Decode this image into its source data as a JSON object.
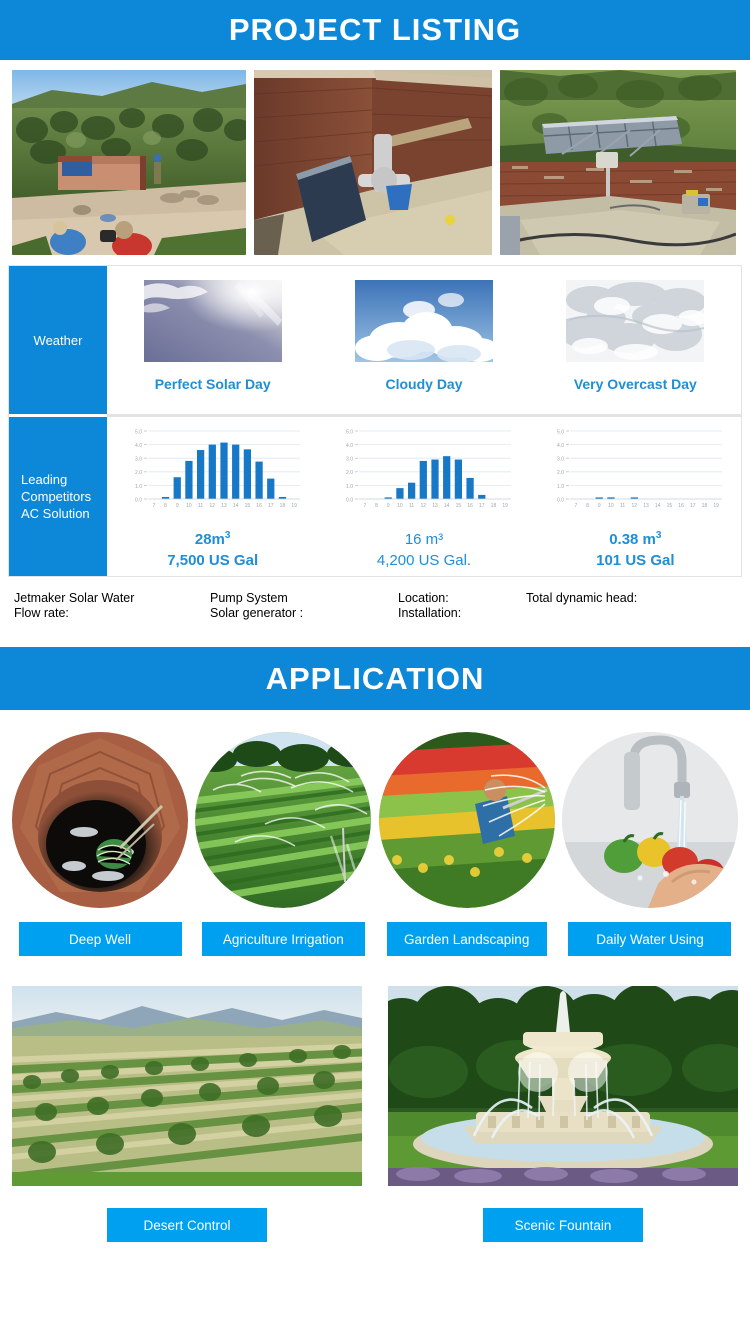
{
  "sections": {
    "project_listing": {
      "title": "PROJECT LISTING"
    },
    "application": {
      "title": "APPLICATION"
    }
  },
  "colors": {
    "banner_blue": "#0d87d8",
    "tag_blue": "#00a0f0",
    "chart_bar_blue": "#1878c8",
    "caption_blue": "#1f8ed8"
  },
  "project_photos": [
    {
      "name": "solar-pump-house-construction"
    },
    {
      "name": "reservoir-tank-interior"
    },
    {
      "name": "solar-panel-array-on-tank"
    }
  ],
  "comparison_table": {
    "row_labels": {
      "weather": "Weather",
      "competitors_line1": "Leading",
      "competitors_line2": "Competitors",
      "competitors_line3": "AC Solution"
    },
    "columns": [
      {
        "weather_caption": "Perfect Solar Day",
        "weather_image": "sunny-sky-photo",
        "volume_m3": "28m",
        "volume_exp": "3",
        "volume_gal": "7,500 US Gal",
        "caption_style": "bold"
      },
      {
        "weather_caption": "Cloudy Day",
        "weather_image": "cloudy-sky-photo",
        "volume_m3": "16 m³",
        "volume_exp": "",
        "volume_gal": "4,200 US Gal.",
        "caption_style": "thin"
      },
      {
        "weather_caption": "Very Overcast Day",
        "weather_image": "overcast-sky-photo",
        "volume_m3": "0.38 m",
        "volume_exp": "3",
        "volume_gal": "101 US Gal",
        "caption_style": "bold"
      }
    ]
  },
  "chart_data": [
    {
      "type": "bar",
      "title": "Perfect Solar Day",
      "categories": [
        "7",
        "8",
        "9",
        "10",
        "11",
        "12",
        "13",
        "14",
        "15",
        "16",
        "17",
        "18",
        "19"
      ],
      "values": [
        0,
        0.15,
        1.6,
        2.8,
        3.6,
        4.0,
        4.15,
        4.0,
        3.65,
        2.75,
        1.5,
        0.15,
        0
      ],
      "ytick_labels": [
        "0.0",
        "1.0",
        "2.0",
        "3.0",
        "4.0",
        "5.0"
      ],
      "ylim": [
        0,
        5
      ],
      "xlabel": "",
      "ylabel": "",
      "grid": true,
      "total_m3": "28m3",
      "total_gal": "7,500 US Gal"
    },
    {
      "type": "bar",
      "title": "Cloudy Day",
      "categories": [
        "7",
        "8",
        "9",
        "10",
        "11",
        "12",
        "13",
        "14",
        "15",
        "16",
        "17",
        "18",
        "19"
      ],
      "values": [
        0,
        0,
        0.08,
        0.8,
        1.2,
        2.8,
        2.9,
        3.15,
        2.9,
        1.55,
        0.3,
        0,
        0
      ],
      "ytick_labels": [
        "0.0",
        "1.0",
        "2.0",
        "3.0",
        "4.0",
        "5.0"
      ],
      "ylim": [
        0,
        5
      ],
      "xlabel": "",
      "ylabel": "",
      "grid": true,
      "total_m3": "16 m3",
      "total_gal": "4,200 US Gal."
    },
    {
      "type": "bar",
      "title": "Very Overcast Day",
      "categories": [
        "7",
        "8",
        "9",
        "10",
        "11",
        "12",
        "13",
        "14",
        "15",
        "16",
        "17",
        "18",
        "19"
      ],
      "values": [
        0,
        0,
        0.05,
        0.12,
        0,
        0.06,
        0,
        0,
        0,
        0,
        0,
        0,
        0
      ],
      "ytick_labels": [
        "0.0",
        "1.0",
        "2.0",
        "3.0",
        "4.0",
        "5.0"
      ],
      "ylim": [
        0,
        5
      ],
      "xlabel": "",
      "ylabel": "",
      "grid": true,
      "total_m3": "0.38 m3",
      "total_gal": "101 US Gal"
    }
  ],
  "specs": [
    {
      "line1": "Jetmaker Solar Water",
      "line2": "Flow rate:"
    },
    {
      "line1": "Pump System",
      "line2": "Solar generator :"
    },
    {
      "line1": "Location:",
      "line2": "Installation:"
    },
    {
      "line1": "Total dynamic head:",
      "line2": ""
    }
  ],
  "applications_row1": [
    {
      "label": "Deep Well",
      "image": "deep-well-photo"
    },
    {
      "label": "Agriculture Irrigation",
      "image": "irrigation-sprinkler-photo"
    },
    {
      "label": "Garden Landscaping",
      "image": "garden-watering-photo"
    },
    {
      "label": "Daily Water Using",
      "image": "tap-washing-vegetables-photo"
    }
  ],
  "applications_row2": [
    {
      "label": "Desert Control",
      "image": "desert-control-plantation-photo"
    },
    {
      "label": "Scenic Fountain",
      "image": "scenic-fountain-photo"
    }
  ]
}
